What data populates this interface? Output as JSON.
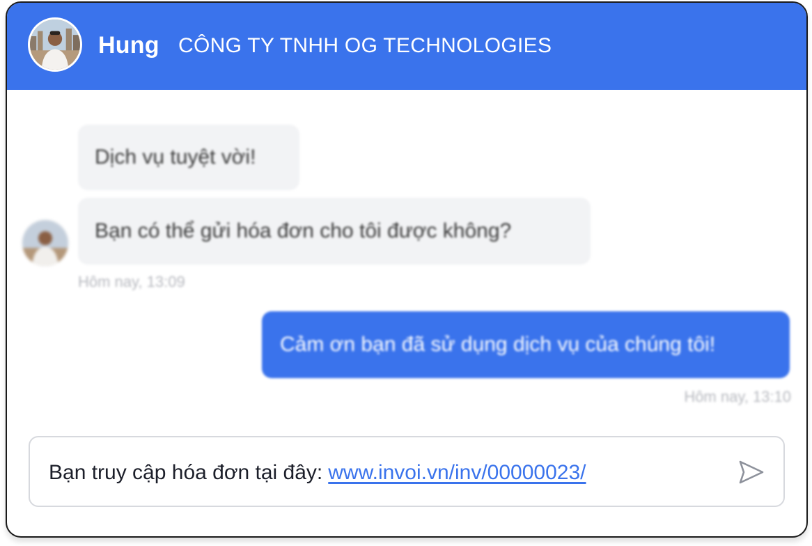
{
  "header": {
    "name": "Hung",
    "company": "CÔNG TY TNHH OG TECHNOLOGIES",
    "background_color": "#3a73ec"
  },
  "messages": {
    "incoming": [
      {
        "text": "Dịch vụ tuyệt vời!"
      },
      {
        "text": "Bạn có thể gửi hóa đơn cho tôi được không?"
      }
    ],
    "incoming_timestamp": "Hôm nay, 13:09",
    "outgoing": [
      {
        "text": "Cảm ơn bạn đã sử dụng dịch vụ của chúng tôi!"
      }
    ],
    "outgoing_timestamp": "Hôm nay, 13:10"
  },
  "composer": {
    "text": "Bạn truy cập hóa đơn tại đây:",
    "link": "www.invoi.vn/inv/00000023/",
    "send_icon": "send-icon"
  },
  "colors": {
    "accent": "#3a73ec",
    "incoming_bubble": "#f2f3f5",
    "timestamp": "#b7b9bf"
  }
}
